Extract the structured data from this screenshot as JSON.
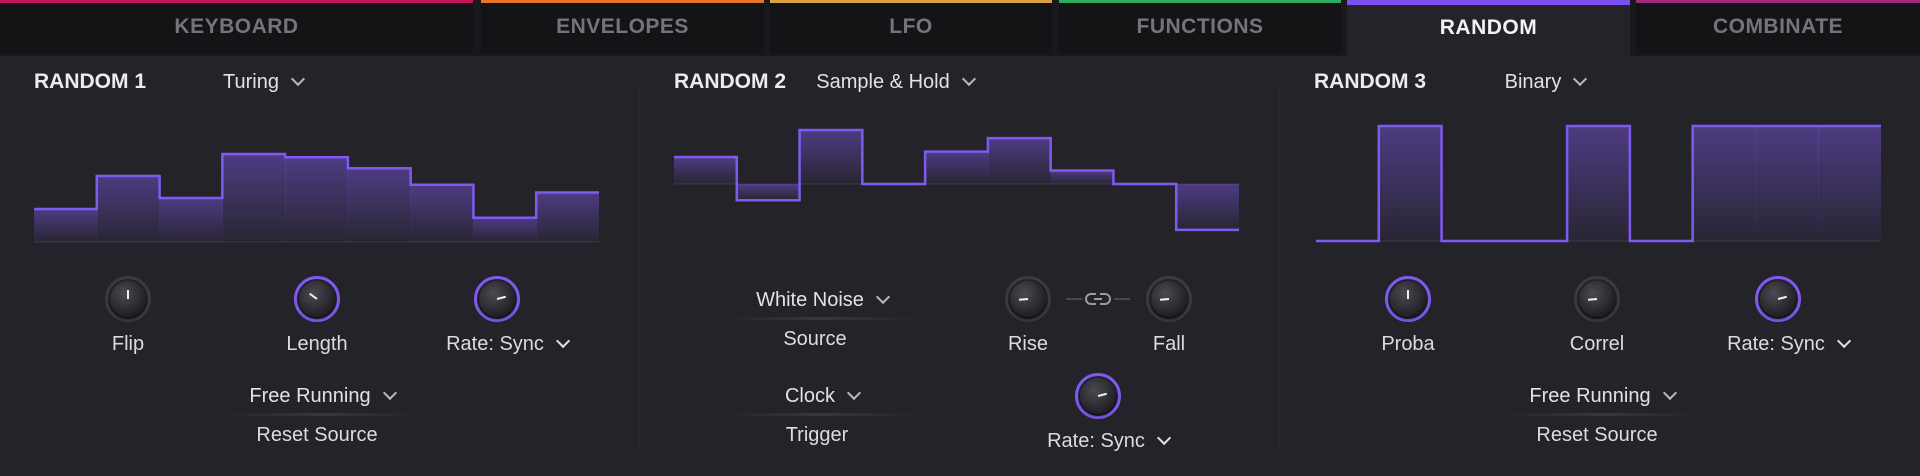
{
  "tabs": [
    {
      "label": "KEYBOARD",
      "color": "#c2185b",
      "active": false
    },
    {
      "label": "ENVELOPES",
      "color": "#e8732a",
      "active": false
    },
    {
      "label": "LFO",
      "color": "#d9a441",
      "active": false
    },
    {
      "label": "FUNCTIONS",
      "color": "#2eaa5a",
      "active": false
    },
    {
      "label": "RANDOM",
      "color": "#7b4ff0",
      "active": true
    },
    {
      "label": "COMBINATE",
      "color": "#a02a7a",
      "active": false
    }
  ],
  "accent": "#7f5af0",
  "random1": {
    "title": "RANDOM 1",
    "mode": "Turing",
    "knobs": [
      {
        "label": "Flip",
        "level": 0.5
      },
      {
        "label": "Length",
        "level": 0.3
      },
      {
        "label": "Rate: Sync",
        "level": 0.78
      }
    ],
    "mode2": "Free Running",
    "mode2_label": "Reset Source",
    "steps": [
      0.3,
      0.6,
      0.4,
      0.8,
      0.77,
      0.67,
      0.52,
      0.22,
      0.45
    ]
  },
  "random2": {
    "title": "RANDOM 2",
    "mode": "Sample & Hold",
    "source_value": "White Noise",
    "source_label": "Source",
    "trigger_value": "Clock",
    "trigger_label": "Trigger",
    "knobs": [
      {
        "label": "Rise",
        "level": 0.15
      },
      {
        "label": "Fall",
        "level": 0.15
      },
      {
        "label": "Rate: Sync",
        "level": 0.78
      }
    ],
    "steps": [
      0.5,
      -0.3,
      1.0,
      0.0,
      0.6,
      0.85,
      0.25,
      0.0,
      -0.85
    ]
  },
  "random3": {
    "title": "RANDOM 3",
    "mode": "Binary",
    "knobs": [
      {
        "label": "Proba",
        "level": 0.5
      },
      {
        "label": "Correl",
        "level": 0.15
      },
      {
        "label": "Rate: Sync",
        "level": 0.78
      }
    ],
    "mode2": "Free Running",
    "mode2_label": "Reset Source",
    "steps": [
      0,
      1,
      0,
      0,
      1,
      0,
      1,
      1,
      1
    ]
  }
}
